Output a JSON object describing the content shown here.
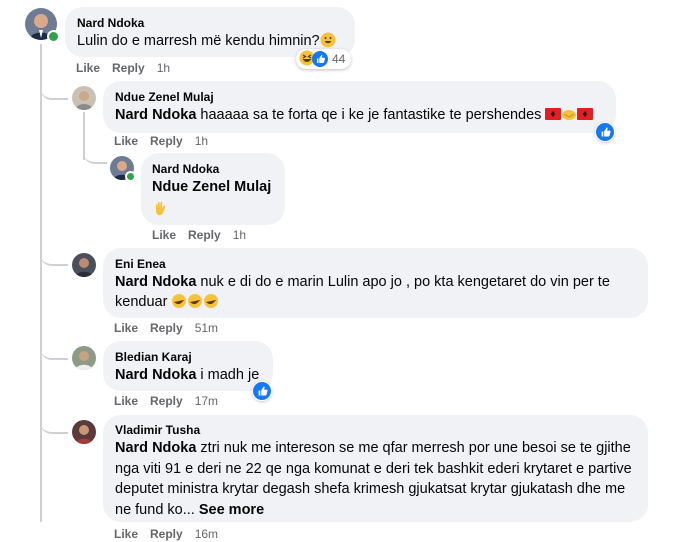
{
  "comments": [
    {
      "author": "Nard Ndoka",
      "text": "Lulin do e marresh më kendu himnin?",
      "time": "1h",
      "reaction_count": "44"
    },
    {
      "author": "Ndue Zenel Mulaj",
      "mention": "Nard Ndoka",
      "text": " haaaaa sa te forta qe i ke je fantastike te pershendes",
      "time": "1h"
    },
    {
      "author": "Nard Ndoka",
      "mention": "Ndue Zenel Mulaj",
      "time": "1h"
    },
    {
      "author": "Eni Enea",
      "mention": "Nard Ndoka",
      "text": " nuk e di do e marin Lulin apo jo , po kta kengetaret do vin per te kenduar",
      "time": "51m"
    },
    {
      "author": "Bledian Karaj",
      "mention": "Nard Ndoka",
      "text": " i madh je",
      "time": "17m"
    },
    {
      "author": "Vladimir Tusha",
      "mention": "Nard Ndoka",
      "text": " ztri nuk me intereson se me qfar merresh por une besoi se te gjithe nga viti 91 e deri ne 22 qe nga komunat e deri tek bashkit ederi krytaret e partive deputet ministra krytar degash shefa krimesh gjukatsat krytar gjukatash dhe me ne fund ko...",
      "see_more": "See more",
      "time": "16m"
    }
  ],
  "actions": {
    "like": "Like",
    "reply": "Reply"
  },
  "colors": {
    "bubble": "#f0f2f5",
    "like_blue": "#1877f2",
    "online": "#31a24c",
    "meta": "#65676b"
  }
}
